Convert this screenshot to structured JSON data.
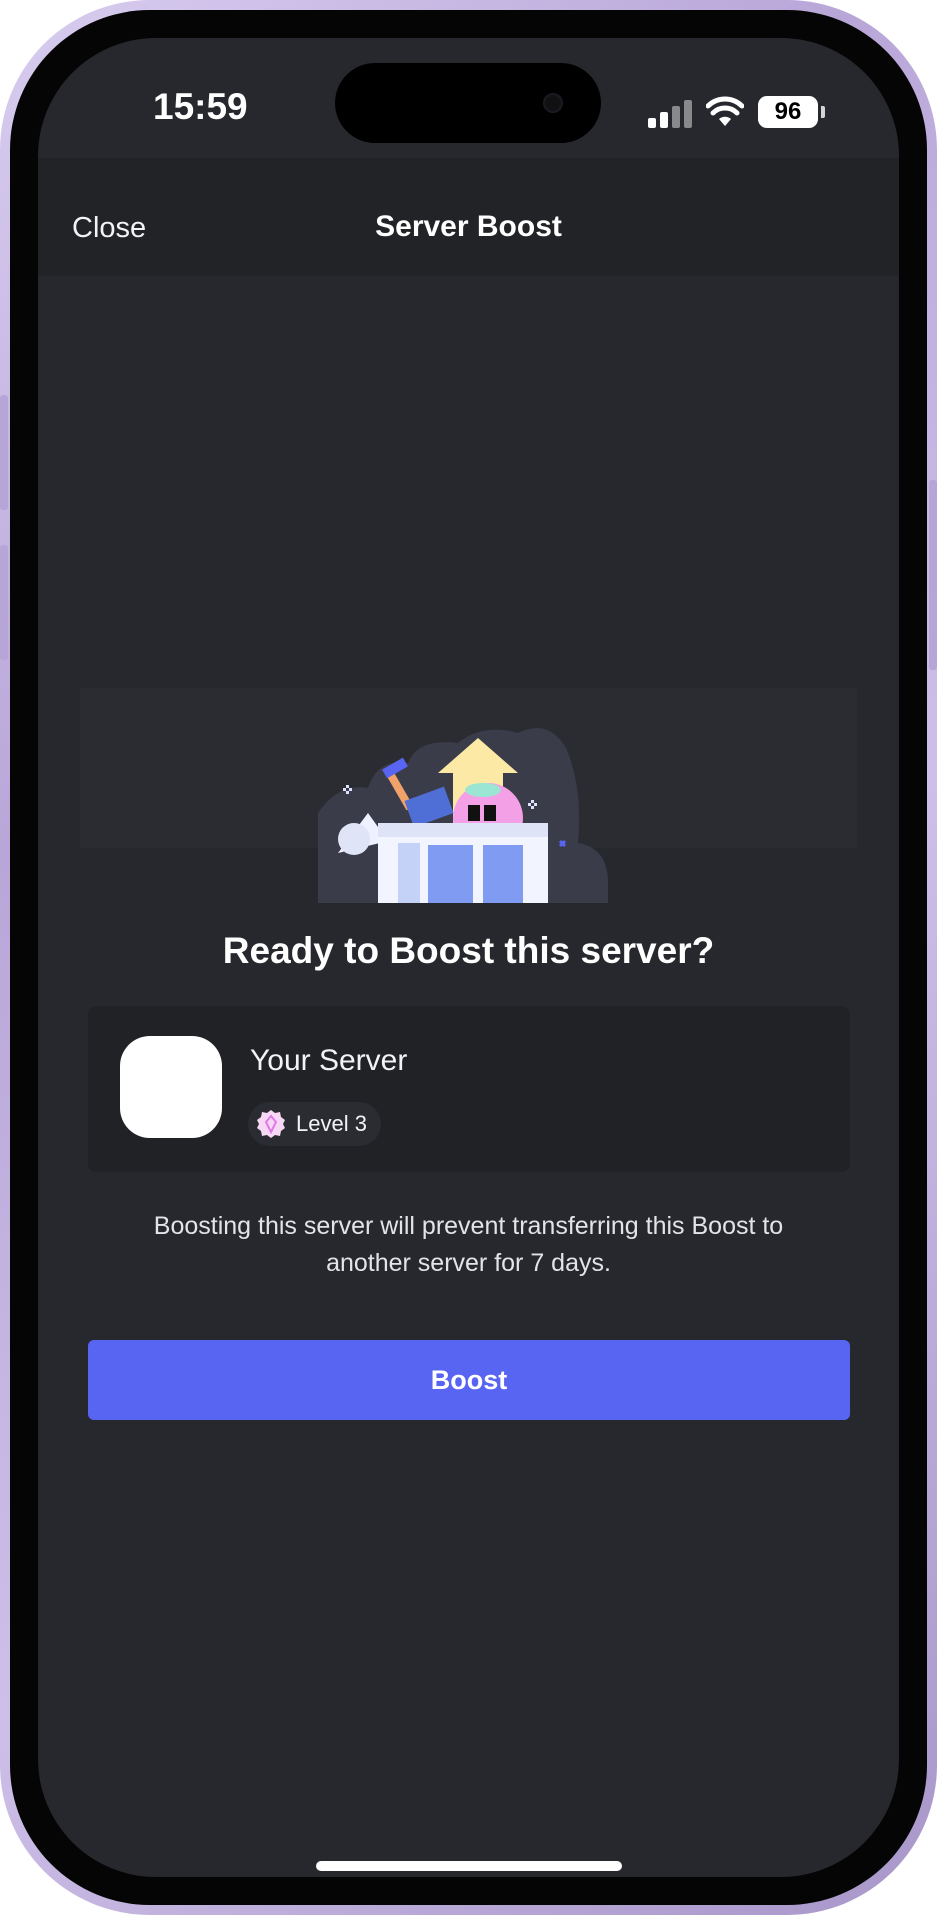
{
  "status_bar": {
    "time": "15:59",
    "battery": "96",
    "icons": [
      "cellular-signal-icon",
      "wifi-icon",
      "battery-icon"
    ]
  },
  "nav": {
    "close_label": "Close",
    "title": "Server Boost"
  },
  "illustration": {
    "name": "server-boost-illustration"
  },
  "main": {
    "heading": "Ready to Boost this server?",
    "server": {
      "name": "Your Server",
      "level_label": "Level 3",
      "level_icon": "boost-gem-icon"
    },
    "note": "Boosting this server will prevent transferring this Boost to another server for 7 days.",
    "boost_button": "Boost"
  },
  "colors": {
    "background": "#27282d",
    "navbar": "#222327",
    "card": "#212226",
    "accent": "#5865f2",
    "level_icon": "#f47fff"
  }
}
